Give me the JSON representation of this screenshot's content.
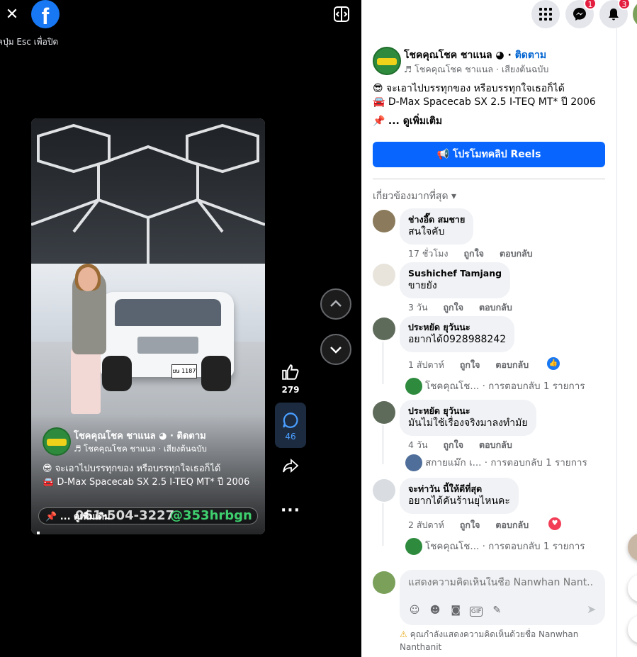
{
  "viewer": {
    "close_icon": "close-icon",
    "esc_hint": "คปุ่ม Esc เพื่อปิด",
    "logo_letter": "f"
  },
  "video": {
    "channel_name": "โชคคุณโชค ชาแนล ◕ · ติดตาม",
    "audio": "♬ โชคคุณโชค ชาแนล · เสียงต้นฉบับ",
    "line1": "😎 จะเอาไปบรรทุกของ หรือบรรทุกใจเธอก็ได้",
    "line2": "🚘 D-Max Spacecab SX 2.5 I-TEQ MT* ปี 2006",
    "see_more": "📌 ... ดูเพิ่มเติม",
    "phone": "061-504-3227",
    "handle": "@353hrbgn",
    "plate": "ยษ 1187"
  },
  "actions": {
    "likes": "279",
    "comments": "46"
  },
  "header": {
    "messenger_badge": "1",
    "notifications_badge": "3"
  },
  "panel": {
    "page_name": "โชคคุณโชค ชาแนล",
    "verified": "◕",
    "follow": "ติดตาม",
    "audio": "♬ โชคคุณโชค ชาแนล · เสียงต้นฉบับ",
    "desc_line1": "😎 จะเอาไปบรรทุกของ หรือบรรทุกใจเธอก็ได้",
    "desc_line2": "🚘 D-Max Spacecab SX 2.5 I-TEQ MT* ปี 2006",
    "desc_pin": "📌",
    "see_more": "... ดูเพิ่มเติม",
    "promo_button": "โปรโมทคลิป Reels",
    "sort_label": "เกี่ยวข้องมากที่สุด ▾"
  },
  "comments": [
    {
      "author": "ช่างอี๊ด สมชาย",
      "text": "สนใจคับ",
      "time": "17 ชั่วโมง",
      "like": "ถูกใจ",
      "reply": "ตอบกลับ"
    },
    {
      "author": "Sushichef Tamjang",
      "text": "ขายยัง",
      "time": "3 วัน",
      "like": "ถูกใจ",
      "reply": "ตอบกลับ"
    },
    {
      "author": "ประหยัด ยุวันนะ",
      "text": "อยากได้0928988242",
      "time": "1 สัปดาห์",
      "like": "ถูกใจ",
      "reply": "ตอบกลับ",
      "reply_row": "โชคคุณโช... · การตอบกลับ 1 รายการ"
    },
    {
      "author": "ประหยัด ยุวันนะ",
      "text": "มันไม่ใช้เรื่องจริงมาลงทำมัย",
      "time": "4 วัน",
      "like": "ถูกใจ",
      "reply": "ตอบกลับ",
      "reply_row": "สกายแม๊ก เ... · การตอบกลับ 1 รายการ"
    },
    {
      "author": "จะท่าวัน นี้ให้ดีที่สุด",
      "text": "อยากได้คันร้านยุไหนคะ",
      "time": "2 สัปดาห์",
      "like": "ถูกใจ",
      "reply": "ตอบกลับ",
      "reply_row": "โชคคุณโช... · การตอบกลับ 1 รายการ"
    }
  ],
  "composer": {
    "placeholder": "แสดงความคิดเห็นในชื่อ Nanwhan Nant...",
    "warning": "คุณกำลังแสดงความคิดเห็นด้วยชื่อ Nanwhan Nanthanit"
  },
  "colors": {
    "accent": "#0866ff",
    "badge": "#e41e3f",
    "like_reaction": "#1877f2",
    "love_reaction": "#f33e58"
  }
}
